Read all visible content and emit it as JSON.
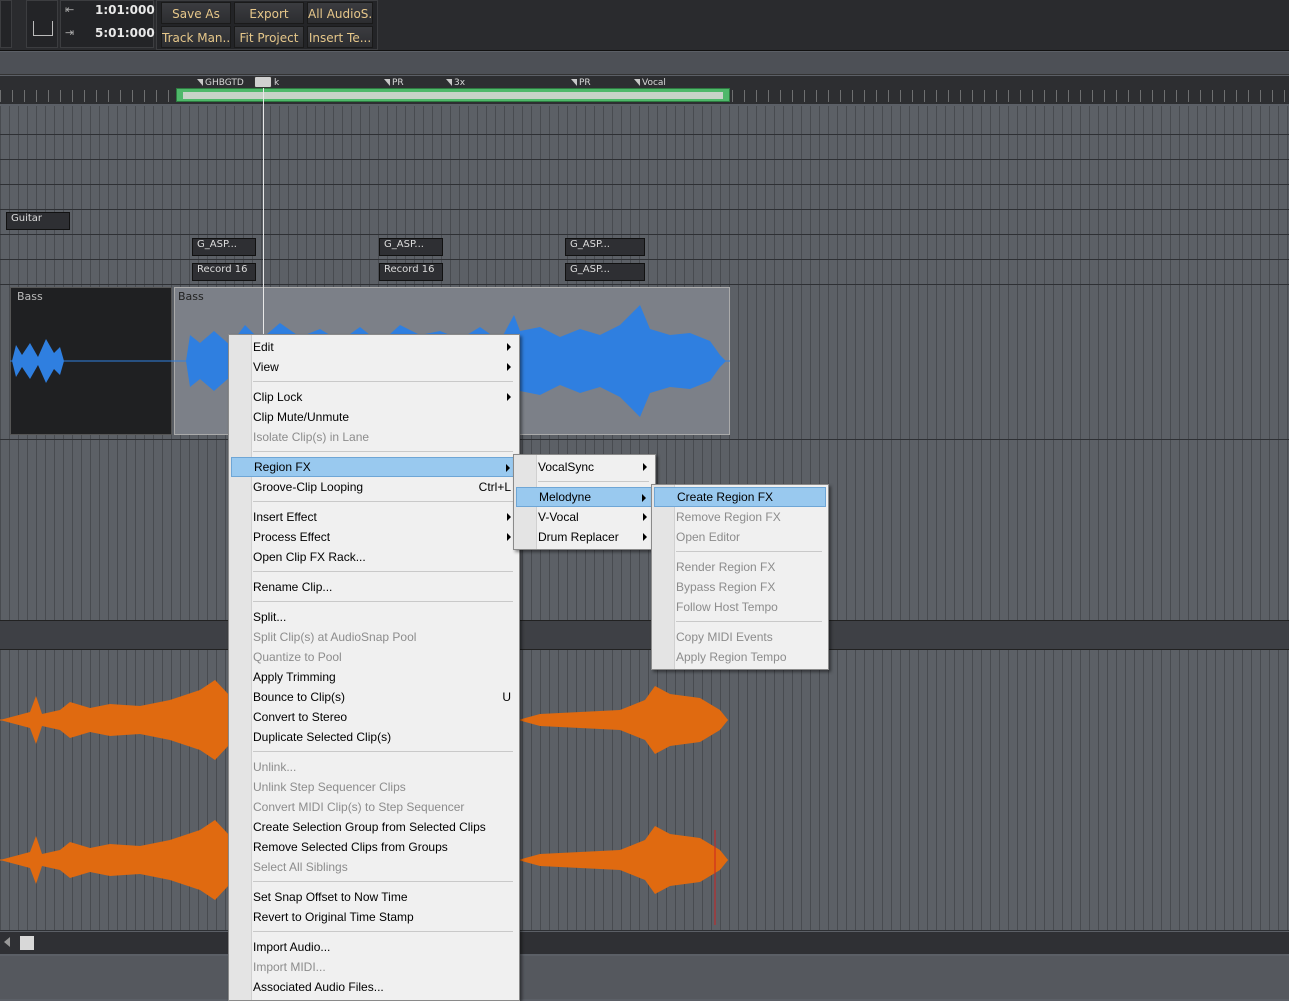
{
  "toolbar": {
    "time1": "1:01:000",
    "time2": "5:01:000",
    "buttons_row1": [
      "Save As",
      "Export",
      "All AudioS..."
    ],
    "buttons_row2": [
      "Track Man...",
      "Fit Project",
      "Insert Te..."
    ]
  },
  "ruler": {
    "markers": [
      "GHBGTD",
      "k",
      "PR",
      "3x",
      "PR",
      "Vocal"
    ]
  },
  "tracks": {
    "guitar_label": "Guitar",
    "small_clips": [
      "G_ASP...",
      "Record 16",
      "G_ASP...",
      "Record 16",
      "G_ASP...",
      "G_ASP..."
    ],
    "bass_clip1": "Bass",
    "bass_clip2": "Bass"
  },
  "colors": {
    "waveform_blue": "#2f7fe0",
    "waveform_orange": "#e06a10",
    "menu_highlight": "#99c9ef"
  },
  "context_menu": {
    "items": [
      {
        "label": "Edit",
        "submenu": true
      },
      {
        "label": "View",
        "submenu": true
      },
      {
        "label": "Clip Lock",
        "submenu": true
      },
      {
        "label": "Clip Mute/Unmute"
      },
      {
        "label": "Isolate Clip(s) in Lane",
        "disabled": true
      },
      {
        "label": "Region FX",
        "submenu": true,
        "highlight": true
      },
      {
        "label": "Groove-Clip Looping",
        "shortcut": "Ctrl+L"
      },
      {
        "label": "Insert Effect",
        "submenu": true
      },
      {
        "label": "Process Effect",
        "submenu": true
      },
      {
        "label": "Open Clip FX Rack..."
      },
      {
        "label": "Rename Clip..."
      },
      {
        "label": "Split..."
      },
      {
        "label": "Split Clip(s) at AudioSnap Pool",
        "disabled": true
      },
      {
        "label": "Quantize to Pool",
        "disabled": true
      },
      {
        "label": "Apply Trimming"
      },
      {
        "label": "Bounce to Clip(s)",
        "shortcut": "U"
      },
      {
        "label": "Convert to Stereo"
      },
      {
        "label": "Duplicate Selected Clip(s)"
      },
      {
        "label": "Unlink...",
        "disabled": true
      },
      {
        "label": "Unlink Step Sequencer Clips",
        "disabled": true
      },
      {
        "label": "Convert MIDI Clip(s) to Step Sequencer",
        "disabled": true
      },
      {
        "label": "Create Selection Group from Selected Clips"
      },
      {
        "label": "Remove Selected Clips from Groups"
      },
      {
        "label": "Select All Siblings",
        "disabled": true
      },
      {
        "label": "Set Snap Offset to Now Time"
      },
      {
        "label": "Revert to Original Time Stamp"
      },
      {
        "label": "Import Audio..."
      },
      {
        "label": "Import MIDI...",
        "disabled": true
      },
      {
        "label": "Associated Audio Files..."
      }
    ]
  },
  "region_fx_menu": {
    "items": [
      {
        "label": "VocalSync",
        "submenu": true
      },
      {
        "label": "Melodyne",
        "submenu": true,
        "highlight": true
      },
      {
        "label": "V-Vocal",
        "submenu": true
      },
      {
        "label": "Drum Replacer",
        "submenu": true
      }
    ]
  },
  "melodyne_menu": {
    "items": [
      {
        "label": "Create Region FX",
        "highlight": true
      },
      {
        "label": "Remove Region FX",
        "disabled": true
      },
      {
        "label": "Open Editor",
        "disabled": true
      },
      {
        "label": "Render Region FX",
        "disabled": true
      },
      {
        "label": "Bypass Region FX",
        "disabled": true
      },
      {
        "label": "Follow Host Tempo",
        "disabled": true
      },
      {
        "label": "Copy MIDI Events",
        "disabled": true
      },
      {
        "label": "Apply Region Tempo",
        "disabled": true
      }
    ]
  }
}
